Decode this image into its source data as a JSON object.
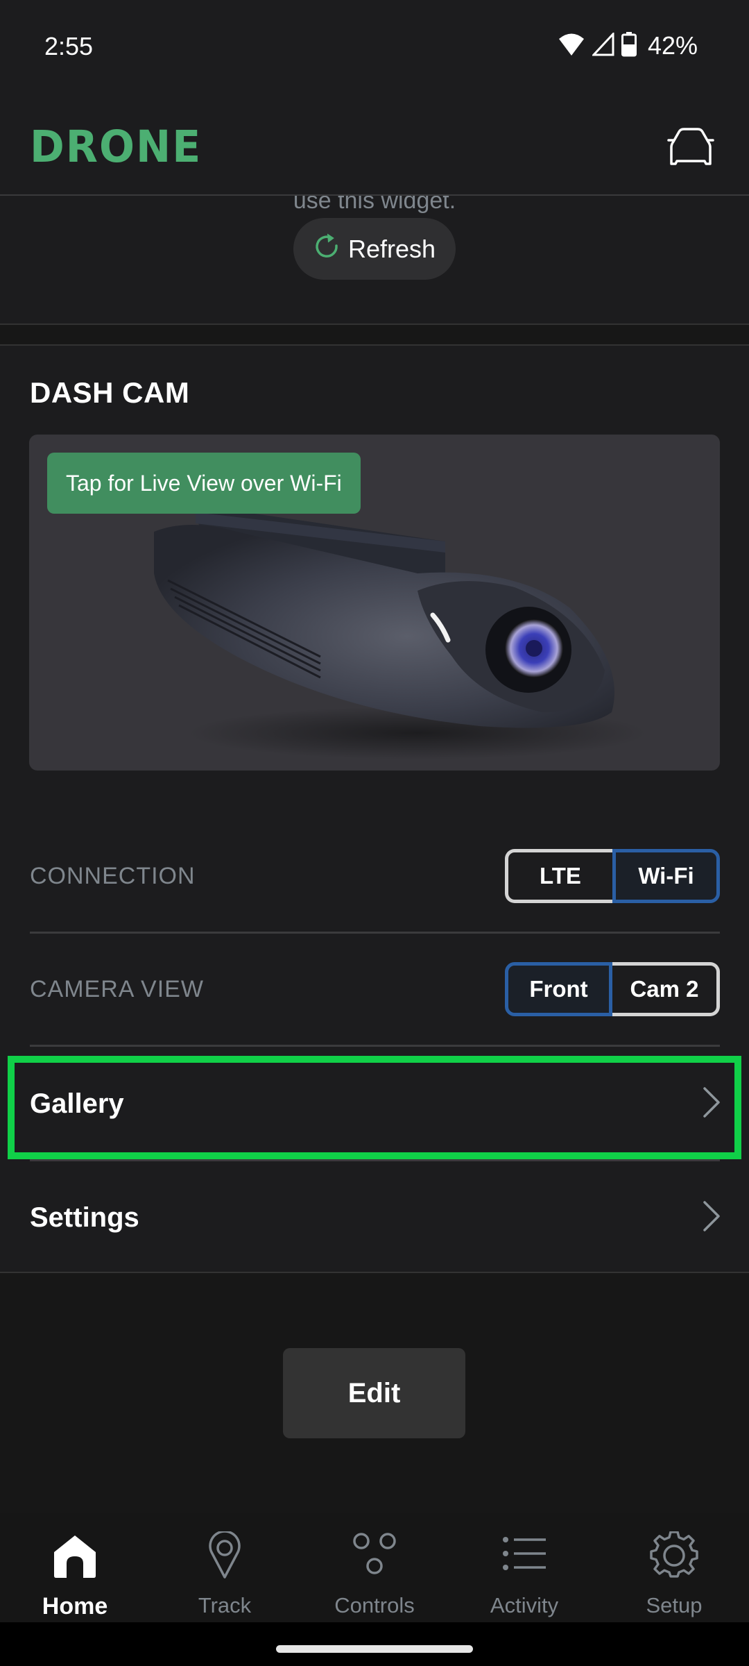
{
  "status_bar": {
    "time": "2:55",
    "battery_percent": "42%",
    "icons": [
      "wifi-icon",
      "cell-signal-icon",
      "battery-icon"
    ]
  },
  "header": {
    "brand": "DRONE",
    "brand_color": "#4caf72",
    "vehicle_icon": "car-icon"
  },
  "widget": {
    "hint_text": "use this widget.",
    "refresh_label": "Refresh",
    "refresh_icon": "refresh-icon"
  },
  "dash_cam": {
    "title": "DASH CAM",
    "live_view_label": "Tap for Live View over Wi-Fi",
    "live_view_color": "#418e5f",
    "connection": {
      "label": "CONNECTION",
      "options": [
        "LTE",
        "Wi-Fi"
      ],
      "selected": "Wi-Fi"
    },
    "camera_view": {
      "label": "CAMERA VIEW",
      "options": [
        "Front",
        "Cam 2"
      ],
      "selected": "Front"
    },
    "links": [
      {
        "label": "Gallery",
        "icon": "chevron-right-icon",
        "highlighted": true
      },
      {
        "label": "Settings",
        "icon": "chevron-right-icon",
        "highlighted": false
      }
    ],
    "accent_selected_color": "#2a5fa5",
    "highlight_color": "#10d048"
  },
  "edit_label": "Edit",
  "bottom_nav": {
    "tabs": [
      {
        "label": "Home",
        "icon": "home-icon",
        "active": true
      },
      {
        "label": "Track",
        "icon": "map-pin-icon",
        "active": false
      },
      {
        "label": "Controls",
        "icon": "controls-icon",
        "active": false
      },
      {
        "label": "Activity",
        "icon": "list-icon",
        "active": false
      },
      {
        "label": "Setup",
        "icon": "gear-icon",
        "active": false
      }
    ]
  }
}
